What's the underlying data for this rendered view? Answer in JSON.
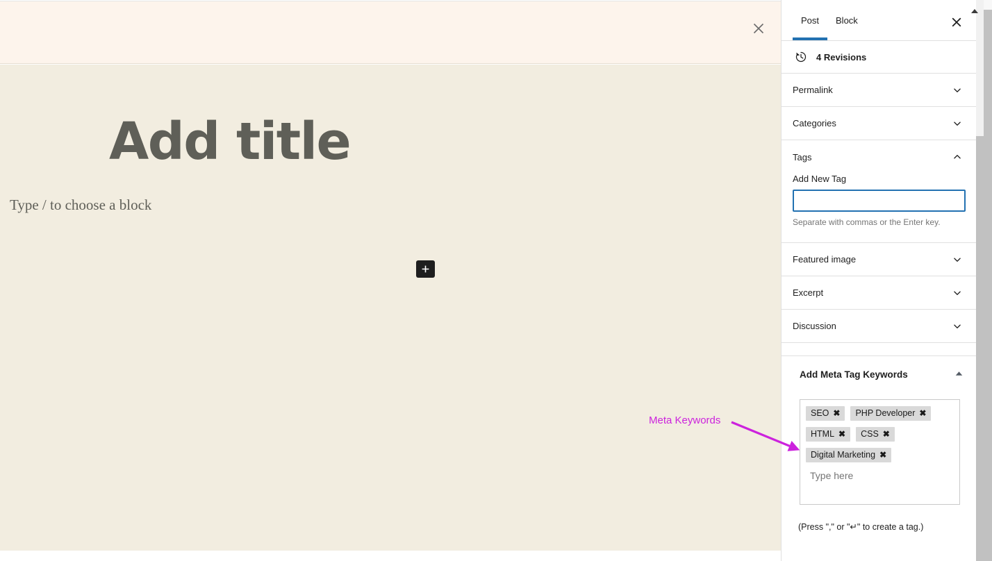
{
  "editor": {
    "notice": {
      "close_icon": "close-x-icon"
    },
    "title_placeholder": "Add title",
    "block_placeholder": "Type / to choose a block",
    "inserter_icon": "plus-icon",
    "background_color": "#f2ede0",
    "notice_color": "#fdf4ec"
  },
  "annotation": {
    "label": "Meta Keywords",
    "color": "#cc22dd",
    "arrow_icon": "arrow-right-icon"
  },
  "sidebar": {
    "tabs": [
      {
        "label": "Post",
        "active": true
      },
      {
        "label": "Block",
        "active": false
      }
    ],
    "close_icon": "close-x-icon",
    "active_tab_color": "#2271b1",
    "revisions": {
      "icon": "history-clock-icon",
      "label": "4 Revisions"
    },
    "panels": [
      {
        "label": "Permalink",
        "icon": "chevron-down-icon",
        "expanded": false
      },
      {
        "label": "Categories",
        "icon": "chevron-down-icon",
        "expanded": false
      }
    ],
    "tags_panel": {
      "label": "Tags",
      "icon": "chevron-up-icon",
      "expanded": true,
      "field_label": "Add New Tag",
      "input_value": "",
      "input_placeholder": "",
      "hint": "Separate with commas or the Enter key."
    },
    "panels_after": [
      {
        "label": "Featured image",
        "icon": "chevron-down-icon",
        "expanded": false
      },
      {
        "label": "Excerpt",
        "icon": "chevron-down-icon",
        "expanded": false
      },
      {
        "label": "Discussion",
        "icon": "chevron-down-icon",
        "expanded": false
      }
    ],
    "meta_panel": {
      "title": "Add Meta Tag Keywords",
      "toggle_icon": "caret-up-icon",
      "expanded": true,
      "keywords": [
        [
          "SEO",
          "PHP Developer"
        ],
        [
          "HTML",
          "CSS"
        ],
        [
          "Digital Marketing"
        ]
      ],
      "remove_glyph": "✖",
      "input_placeholder": "Type here",
      "input_value": "",
      "hint": "(Press \",\" or \"↵\" to create a tag.)"
    }
  },
  "scrollbars": {
    "panel_scrollbar": "vertical-scrollbar",
    "outer_scrollbar": "vertical-scrollbar",
    "up_arrow_icon": "scroll-up-arrow-icon"
  }
}
